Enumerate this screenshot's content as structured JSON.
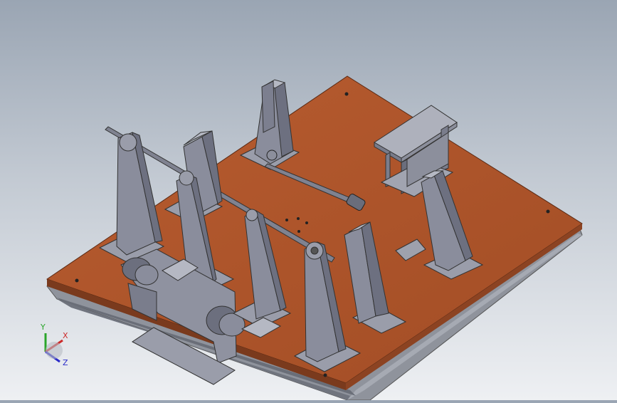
{
  "viewport": {
    "background_top": "#9aa5b3",
    "background_bottom": "#eef0f3"
  },
  "model": {
    "base_plate_color": "#b0562c",
    "base_plate_edge_color": "#7a3a1d",
    "part_color": "#8a8d9c",
    "part_dark_color": "#5e6170",
    "frame_color": "#9a9ea8"
  },
  "triad": {
    "x_label": "X",
    "y_label": "Y",
    "z_label": "Z",
    "x_color": "#cc2a2a",
    "y_color": "#2aa52a",
    "z_color": "#2a2ac8"
  }
}
